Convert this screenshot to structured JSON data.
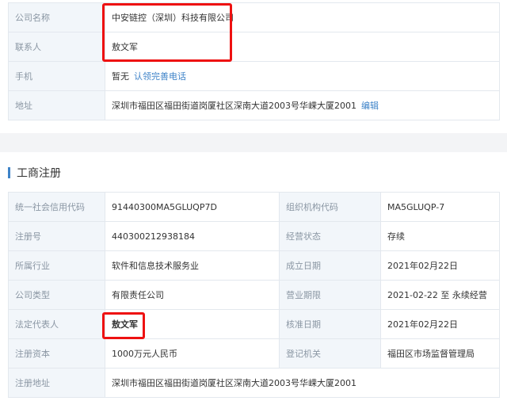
{
  "contact": {
    "company_label": "公司名称",
    "company_value": "中安链控（深圳）科技有限公司",
    "contact_label": "联系人",
    "contact_value": "敖文军",
    "phone_label": "手机",
    "phone_value": "暂无",
    "phone_link": "认领完善电话",
    "address_label": "地址",
    "address_value": "深圳市福田区福田街道岗厦社区深南大道2003号华嵘大厦2001",
    "address_link": "编辑"
  },
  "registration": {
    "title": "工商注册",
    "rows": [
      {
        "l1": "统一社会信用代码",
        "v1": "91440300MA5GLUQP7D",
        "l2": "组织机构代码",
        "v2": "MA5GLUQP-7"
      },
      {
        "l1": "注册号",
        "v1": "440300212938184",
        "l2": "经营状态",
        "v2": "存续"
      },
      {
        "l1": "所属行业",
        "v1": "软件和信息技术服务业",
        "l2": "成立日期",
        "v2": "2021年02月22日"
      },
      {
        "l1": "公司类型",
        "v1": "有限责任公司",
        "l2": "营业期限",
        "v2": "2021-02-22 至 永续经营"
      },
      {
        "l1": "法定代表人",
        "v1": "敖文军",
        "l2": "核准日期",
        "v2": "2021年02月22日"
      },
      {
        "l1": "注册资本",
        "v1": "1000万元人民币",
        "l2": "登记机关",
        "v2": "福田区市场监督管理局"
      }
    ],
    "reg_address_label": "注册地址",
    "reg_address_value": "深圳市福田区福田街道岗厦社区深南大道2003号华嵘大厦2001"
  },
  "colors": {
    "highlight": "#e11111",
    "accent": "#3e83c8",
    "label_bg": "#f2f6fa"
  }
}
